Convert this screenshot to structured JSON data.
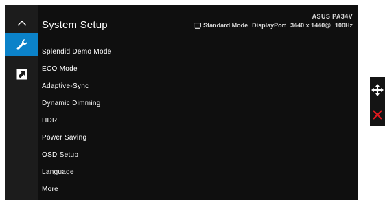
{
  "osd": {
    "title": "System Setup",
    "model": "ASUS PA34V",
    "status": {
      "mode": "Standard Mode",
      "input": "DisplayPort",
      "resolution": "3440 x 1440@",
      "refresh": "100Hz"
    },
    "menu_items": [
      "Splendid Demo Mode",
      "ECO Mode",
      "Adaptive-Sync",
      "Dynamic Dimming",
      "HDR",
      "Power Saving",
      "OSD Setup",
      "Language",
      "More"
    ]
  },
  "sidebar": {
    "icons": [
      "chevron-up-icon",
      "wrench-icon",
      "shortcut-arrow-icon"
    ],
    "active_index": 1
  },
  "navigation": {
    "icons": [
      "four-way-navigation-icon",
      "exit-x-icon"
    ]
  },
  "colors": {
    "osd_background": "#0f0f0f",
    "sidebar_background": "#1c1c1c",
    "accent": "#0b82c9",
    "exit_red": "#e0191f",
    "text": "#ffffff"
  }
}
